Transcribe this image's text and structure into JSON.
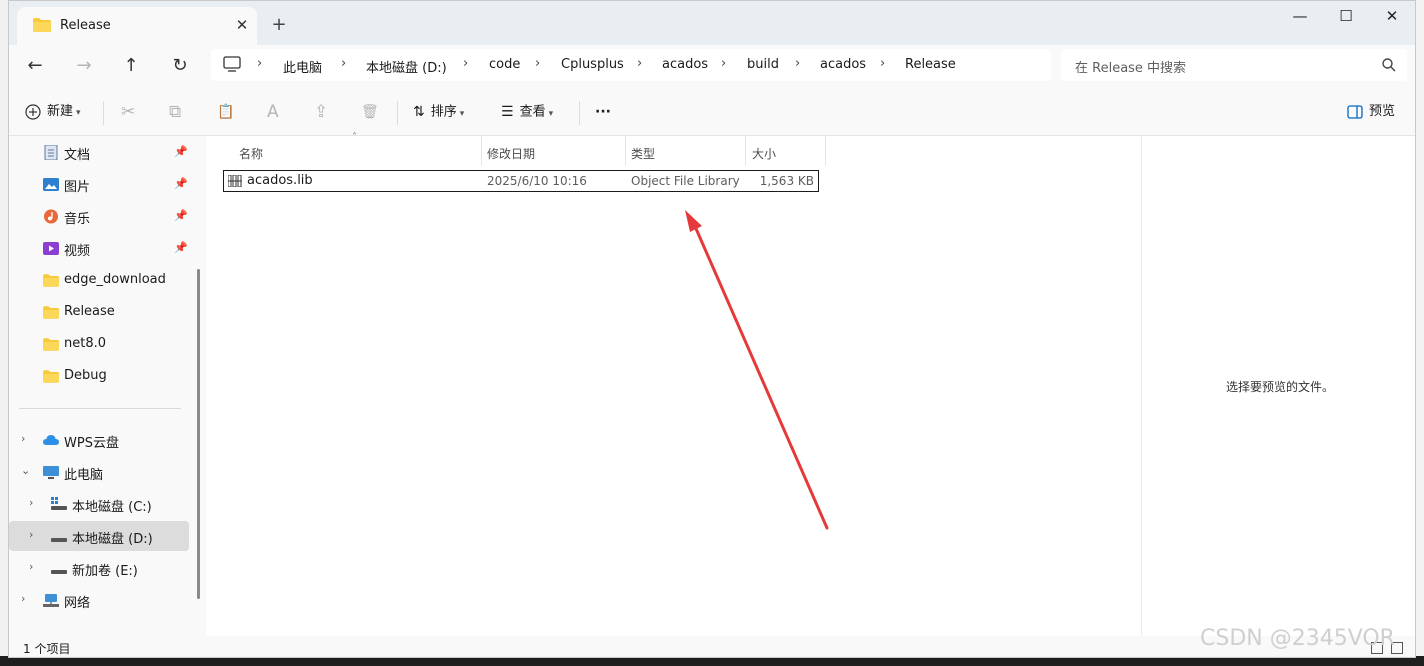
{
  "window": {
    "tab_title": "Release",
    "close_tab": "✕",
    "new_tab": "+",
    "minimize": "—",
    "maximize": "☐",
    "close": "✕"
  },
  "nav": {
    "back": "←",
    "forward": "→",
    "up": "↑",
    "refresh": "↻",
    "breadcrumbs": [
      "此电脑",
      "本地磁盘 (D:)",
      "code",
      "Cplusplus",
      "acados",
      "build",
      "acados",
      "Release"
    ],
    "separator": "›",
    "search_placeholder": "在 Release 中搜索"
  },
  "commands": {
    "new_label": "新建",
    "sort_label": "排序",
    "view_label": "查看",
    "more_label": "···",
    "preview_label": "预览",
    "cut_icon": "✂",
    "copy_icon": "⧉",
    "paste_icon": "📋",
    "rename_icon": "A",
    "share_icon": "⇪",
    "delete_icon": "🗑"
  },
  "sidebar": {
    "quick": [
      {
        "label": "文档",
        "icon": "document-icon",
        "pinned": true
      },
      {
        "label": "图片",
        "icon": "pictures-icon",
        "pinned": true
      },
      {
        "label": "音乐",
        "icon": "music-icon",
        "pinned": true
      },
      {
        "label": "视频",
        "icon": "video-icon",
        "pinned": true
      },
      {
        "label": "edge_download",
        "icon": "folder-icon",
        "pinned": false
      },
      {
        "label": "Release",
        "icon": "folder-icon",
        "pinned": false
      },
      {
        "label": "net8.0",
        "icon": "folder-icon",
        "pinned": false
      },
      {
        "label": "Debug",
        "icon": "folder-icon",
        "pinned": false
      }
    ],
    "tree": [
      {
        "label": "WPS云盘",
        "icon": "cloud-icon",
        "chevron": "›",
        "level": 0
      },
      {
        "label": "此电脑",
        "icon": "computer-icon",
        "chevron": "⌄",
        "level": 0
      },
      {
        "label": "本地磁盘 (C:)",
        "icon": "drive-icon",
        "chevron": "›",
        "level": 1
      },
      {
        "label": "本地磁盘 (D:)",
        "icon": "drive-icon",
        "chevron": "›",
        "level": 1,
        "selected": true
      },
      {
        "label": "新加卷 (E:)",
        "icon": "drive-icon",
        "chevron": "›",
        "level": 1
      },
      {
        "label": "网络",
        "icon": "network-icon",
        "chevron": "›",
        "level": 0
      }
    ],
    "pin_glyph": "📌"
  },
  "columns": {
    "name": "名称",
    "modified": "修改日期",
    "type": "类型",
    "size": "大小"
  },
  "files": [
    {
      "name": "acados.lib",
      "modified": "2025/6/10 10:16",
      "type": "Object File Library",
      "size": "1,563 KB"
    }
  ],
  "preview": {
    "message": "选择要预览的文件。"
  },
  "status": {
    "count": "1 个项目"
  },
  "watermark": "CSDN @2345VOR",
  "colors": {
    "accent": "#0067c0",
    "folder": "#f8c93a",
    "arrow": "#e63a3a"
  }
}
